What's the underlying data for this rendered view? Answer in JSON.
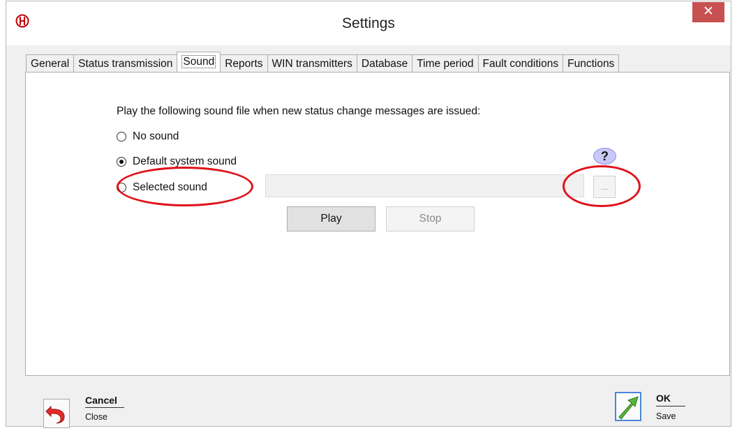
{
  "window": {
    "title": "Settings"
  },
  "tabs": [
    "General",
    "Status transmission",
    "Sound",
    "Reports",
    "WIN transmitters",
    "Database",
    "Time period",
    "Fault conditions",
    "Functions"
  ],
  "active_tab_index": 2,
  "sound": {
    "prompt": "Play the following sound file when new status change messages are issued:",
    "options": [
      {
        "label": "No sound",
        "checked": false
      },
      {
        "label": "Default system sound",
        "checked": true
      },
      {
        "label": "Selected sound",
        "checked": false
      }
    ],
    "file_value": "",
    "browse_label": "...",
    "help_label": "?",
    "play_label": "Play",
    "stop_label": "Stop"
  },
  "footer": {
    "cancel_label": "Cancel",
    "cancel_sub": "Close",
    "ok_label": "OK",
    "ok_sub": "Save"
  },
  "colors": {
    "annotation": "#e0111b",
    "close_button": "#c75050",
    "help_bubble": "#c9c9f7"
  }
}
